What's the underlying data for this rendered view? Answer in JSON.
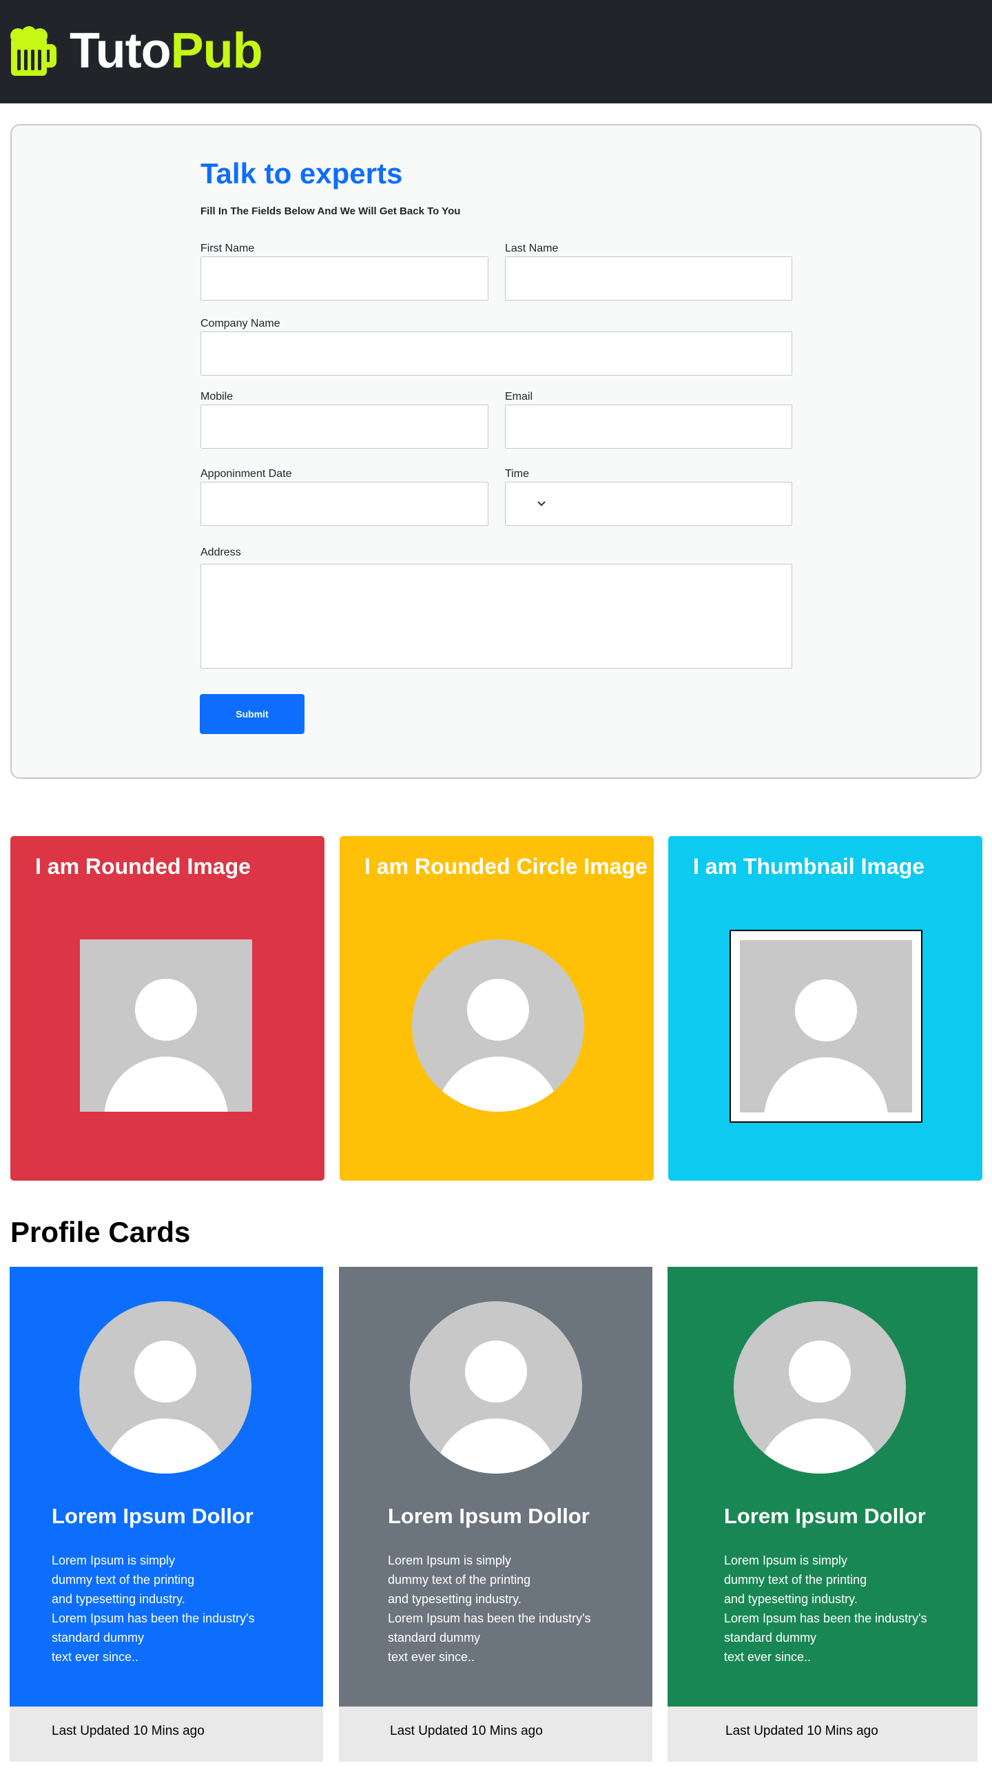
{
  "header": {
    "logo_part1": "Tuto",
    "logo_part2": "Pub",
    "logo_icon": "beer-mug-icon"
  },
  "colors": {
    "header_bg": "#212529",
    "brand_accent": "#c6f715",
    "primary": "#0d6efd",
    "danger": "#dc3545",
    "warning": "#ffc107",
    "info": "#0dcaf0",
    "secondary": "#6c757d",
    "success": "#198754"
  },
  "form": {
    "title": "Talk to experts",
    "subtitle": "Fill In The Fields Below And We Will Get Back To You",
    "first_name_label": "First Name",
    "last_name_label": "Last Name",
    "company_label": "Company Name",
    "mobile_label": "Mobile",
    "email_label": "Email",
    "date_label": "Apponinment Date",
    "time_label": "Time",
    "address_label": "Address",
    "submit_label": "Submit"
  },
  "image_cards": [
    {
      "title": "I am Rounded Image"
    },
    {
      "title": "I am Rounded Circle Image"
    },
    {
      "title": "I am Thumbnail Image"
    }
  ],
  "profiles": {
    "section_title": "Profile Cards",
    "cards": [
      {
        "name": "Lorem Ipsum Dollor",
        "lines": [
          "Lorem Ipsum is simply",
          "dummy text of the printing",
          "and typesetting industry.",
          "Lorem Ipsum has been the industry's",
          "standard dummy",
          "text ever since.."
        ],
        "footer": "Last Updated 10 Mins ago"
      },
      {
        "name": "Lorem Ipsum Dollor",
        "lines": [
          "Lorem Ipsum is simply",
          "dummy text of the printing",
          "and typesetting industry.",
          "Lorem Ipsum has been the industry's",
          "standard dummy",
          "text ever since.."
        ],
        "footer": "Last Updated 10 Mins ago"
      },
      {
        "name": "Lorem Ipsum Dollor",
        "lines": [
          "Lorem Ipsum is simply",
          "dummy text of the printing",
          "and typesetting industry.",
          "Lorem Ipsum has been the industry's",
          "standard dummy",
          "text ever since.."
        ],
        "footer": "Last Updated 10 Mins ago"
      }
    ]
  }
}
